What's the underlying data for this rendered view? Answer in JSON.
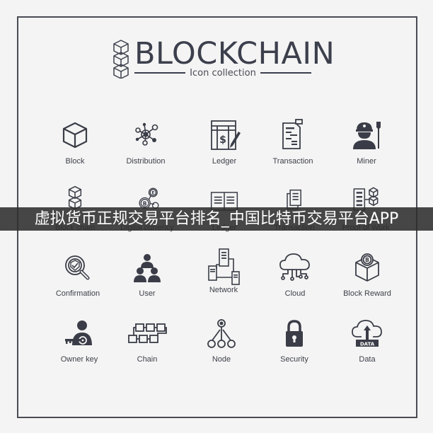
{
  "header": {
    "title": "BLOCKCHAIN",
    "subtitle": "Icon collection"
  },
  "colors": {
    "background": "#f4f4f4",
    "icon": "#3a3d47",
    "frame": "#4a4c55",
    "banner_bg": "#2d2d2d",
    "banner_text": "#ffffff"
  },
  "icons": [
    {
      "label": "Block",
      "icon": "cube-icon"
    },
    {
      "label": "Distribution",
      "icon": "distribution-network-icon"
    },
    {
      "label": "Ledger",
      "icon": "ledger-pen-icon"
    },
    {
      "label": "Transaction",
      "icon": "transaction-document-icon"
    },
    {
      "label": "Miner",
      "icon": "miner-icon"
    },
    {
      "label": "Block chain",
      "icon": "stacked-cubes-icon"
    },
    {
      "label": "Digital currency",
      "icon": "coins-icon"
    },
    {
      "label": "Ledger",
      "icon": "open-book-icon"
    },
    {
      "label": "Transaction",
      "icon": "documents-icon"
    },
    {
      "label": "Proof of Work",
      "icon": "server-cubes-icon"
    },
    {
      "label": "Confirmation",
      "icon": "magnifier-check-icon"
    },
    {
      "label": "User",
      "icon": "users-group-icon"
    },
    {
      "label": "Network",
      "icon": "servers-network-icon"
    },
    {
      "label": "Cloud",
      "icon": "cloud-circuit-icon"
    },
    {
      "label": "Block Reward",
      "icon": "cube-coin-icon"
    },
    {
      "label": "Owner key",
      "icon": "user-key-icon"
    },
    {
      "label": "Chain",
      "icon": "chain-blocks-icon"
    },
    {
      "label": "Node",
      "icon": "node-tree-icon"
    },
    {
      "label": "Security",
      "icon": "padlock-icon"
    },
    {
      "label": "Data",
      "icon": "cloud-upload-data-icon"
    }
  ],
  "coin_letters": {
    "bitcoin": "B",
    "ethereum": "E"
  },
  "data_tag": "DATA",
  "banner": {
    "text": "虚拟货币正规交易平台排名_中国比特币交易平台APP"
  }
}
